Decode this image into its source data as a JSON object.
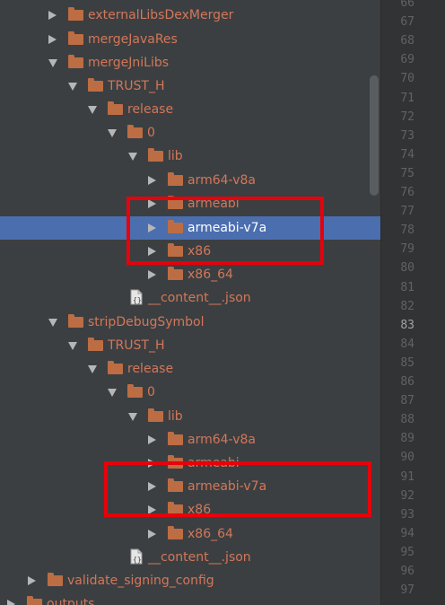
{
  "tree": {
    "rows": [
      {
        "label": "externalLibsDexMerger",
        "type": "folder",
        "expanded": false
      },
      {
        "label": "mergeJavaRes",
        "type": "folder",
        "expanded": false
      },
      {
        "label": "mergeJniLibs",
        "type": "folder",
        "expanded": true
      },
      {
        "label": "TRUST_H",
        "type": "folder",
        "expanded": true
      },
      {
        "label": "release",
        "type": "folder",
        "expanded": true
      },
      {
        "label": "0",
        "type": "folder",
        "expanded": true
      },
      {
        "label": "lib",
        "type": "folder",
        "expanded": true
      },
      {
        "label": "arm64-v8a",
        "type": "folder",
        "expanded": false
      },
      {
        "label": "armeabi",
        "type": "folder",
        "expanded": false
      },
      {
        "label": "armeabi-v7a",
        "type": "folder",
        "expanded": false,
        "selected": true
      },
      {
        "label": "x86",
        "type": "folder",
        "expanded": false
      },
      {
        "label": "x86_64",
        "type": "folder",
        "expanded": false
      },
      {
        "label": "__content__.json",
        "type": "file"
      },
      {
        "label": "stripDebugSymbol",
        "type": "folder",
        "expanded": true
      },
      {
        "label": "TRUST_H",
        "type": "folder",
        "expanded": true
      },
      {
        "label": "release",
        "type": "folder",
        "expanded": true
      },
      {
        "label": "0",
        "type": "folder",
        "expanded": true
      },
      {
        "label": "lib",
        "type": "folder",
        "expanded": true
      },
      {
        "label": "arm64-v8a",
        "type": "folder",
        "expanded": false
      },
      {
        "label": "armeabi",
        "type": "folder",
        "expanded": false
      },
      {
        "label": "armeabi-v7a",
        "type": "folder",
        "expanded": false
      },
      {
        "label": "x86",
        "type": "folder",
        "expanded": false
      },
      {
        "label": "x86_64",
        "type": "folder",
        "expanded": false
      },
      {
        "label": "__content__.json",
        "type": "file"
      },
      {
        "label": "validate_signing_config",
        "type": "folder",
        "expanded": false
      },
      {
        "label": "outputs",
        "type": "folder",
        "expanded": false
      }
    ]
  },
  "gutter": {
    "line_numbers": [
      "66",
      "67",
      "68",
      "69",
      "70",
      "71",
      "72",
      "73",
      "74",
      "75",
      "76",
      "77",
      "78",
      "79",
      "80",
      "81",
      "82",
      "83",
      "84",
      "85",
      "86",
      "87",
      "88",
      "89",
      "90",
      "91",
      "92",
      "93",
      "94",
      "95",
      "96",
      "97"
    ],
    "current_line": "83"
  },
  "colors": {
    "panel_bg": "#3c3f41",
    "selection": "#4b6eaf",
    "folder_icon": "#bd6d43",
    "tree_text": "#d2775a",
    "highlight_box": "#e8000b",
    "gutter_bg": "#313335",
    "line_number": "#606366"
  }
}
